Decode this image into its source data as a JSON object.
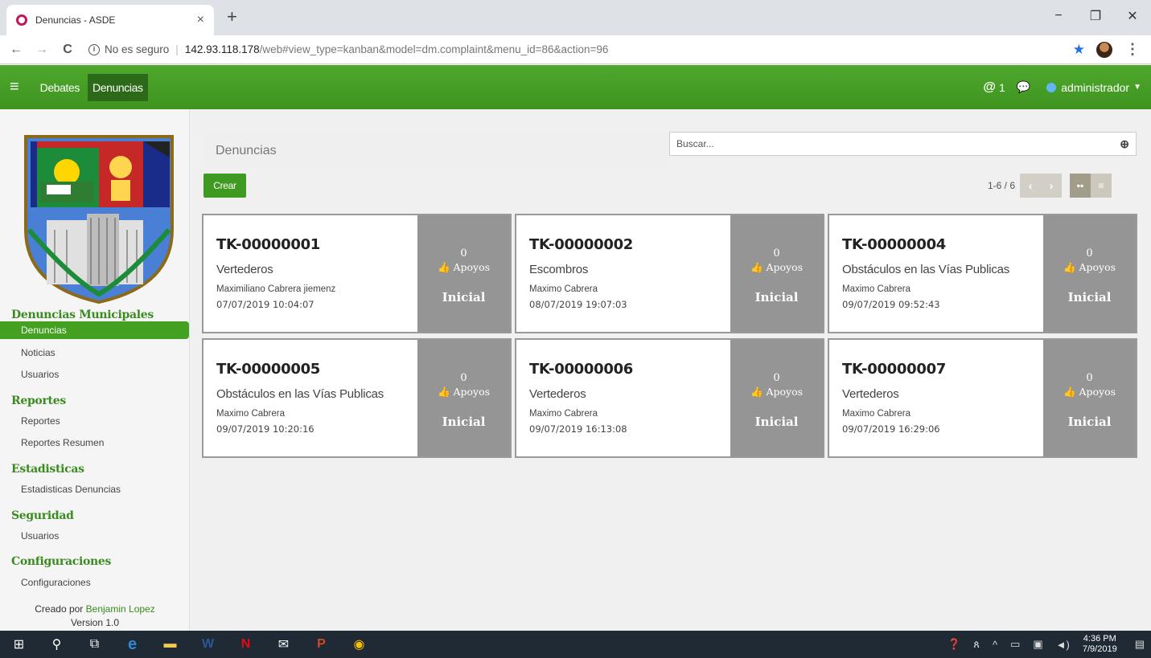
{
  "browser": {
    "tab_title": "Denuncias - ASDE",
    "tab_close": "×",
    "new_tab": "+",
    "win_minimize": "−",
    "win_restore": "❐",
    "win_close": "✕",
    "not_secure": "No es seguro",
    "url_host": "142.93.118.178",
    "url_path": "/web#view_type=kanban&model=dm.complaint&menu_id=86&action=96",
    "back": "←",
    "forward": "→",
    "reload": "C"
  },
  "appbar": {
    "menu": [
      "Debates",
      "Denuncias"
    ],
    "active_menu": "Denuncias",
    "mentions_count": "1",
    "user_name": "administrador"
  },
  "sidebar": {
    "sections": [
      {
        "title": "Denuncias Municipales",
        "items": [
          "Denuncias",
          "Noticias",
          "Usuarios"
        ]
      },
      {
        "title": "Reportes",
        "items": [
          "Reportes",
          "Reportes Resumen"
        ]
      },
      {
        "title": "Estadisticas",
        "items": [
          "Estadisticas Denuncias"
        ]
      },
      {
        "title": "Seguridad",
        "items": [
          "Usuarios"
        ]
      },
      {
        "title": "Configuraciones",
        "items": [
          "Configuraciones"
        ]
      }
    ],
    "footer_prefix": "Creado por",
    "footer_author": "Benjamin Lopez",
    "footer_version": "Version 1.0"
  },
  "main": {
    "breadcrumb": "Denuncias",
    "search_placeholder": "Buscar...",
    "create_label": "Crear",
    "pager": "1-6 / 6"
  },
  "cards": [
    {
      "id": "TK-00000001",
      "category": "Vertederos",
      "person": "Maximiliano Cabrera jiemenz",
      "date": "07/07/2019 10:04:07",
      "count": "0",
      "apoyos": "Apoyos",
      "status": "Inicial"
    },
    {
      "id": "TK-00000002",
      "category": "Escombros",
      "person": "Maximo Cabrera",
      "date": "08/07/2019 19:07:03",
      "count": "0",
      "apoyos": "Apoyos",
      "status": "Inicial"
    },
    {
      "id": "TK-00000004",
      "category": "Obstáculos en las Vías Publicas",
      "person": "Maximo Cabrera",
      "date": "09/07/2019 09:52:43",
      "count": "0",
      "apoyos": "Apoyos",
      "status": "Inicial"
    },
    {
      "id": "TK-00000005",
      "category": "Obstáculos en las Vías Publicas",
      "person": "Maximo Cabrera",
      "date": "09/07/2019 10:20:16",
      "count": "0",
      "apoyos": "Apoyos",
      "status": "Inicial"
    },
    {
      "id": "TK-00000006",
      "category": "Vertederos",
      "person": "Maximo Cabrera",
      "date": "09/07/2019 16:13:08",
      "count": "0",
      "apoyos": "Apoyos",
      "status": "Inicial"
    },
    {
      "id": "TK-00000007",
      "category": "Vertederos",
      "person": "Maximo Cabrera",
      "date": "09/07/2019 16:29:06",
      "count": "0",
      "apoyos": "Apoyos",
      "status": "Inicial"
    }
  ],
  "taskbar": {
    "time": "4:36 PM",
    "date": "7/9/2019"
  },
  "colors": {
    "brand_green": "#43a020",
    "card_status_gray": "#959595"
  }
}
